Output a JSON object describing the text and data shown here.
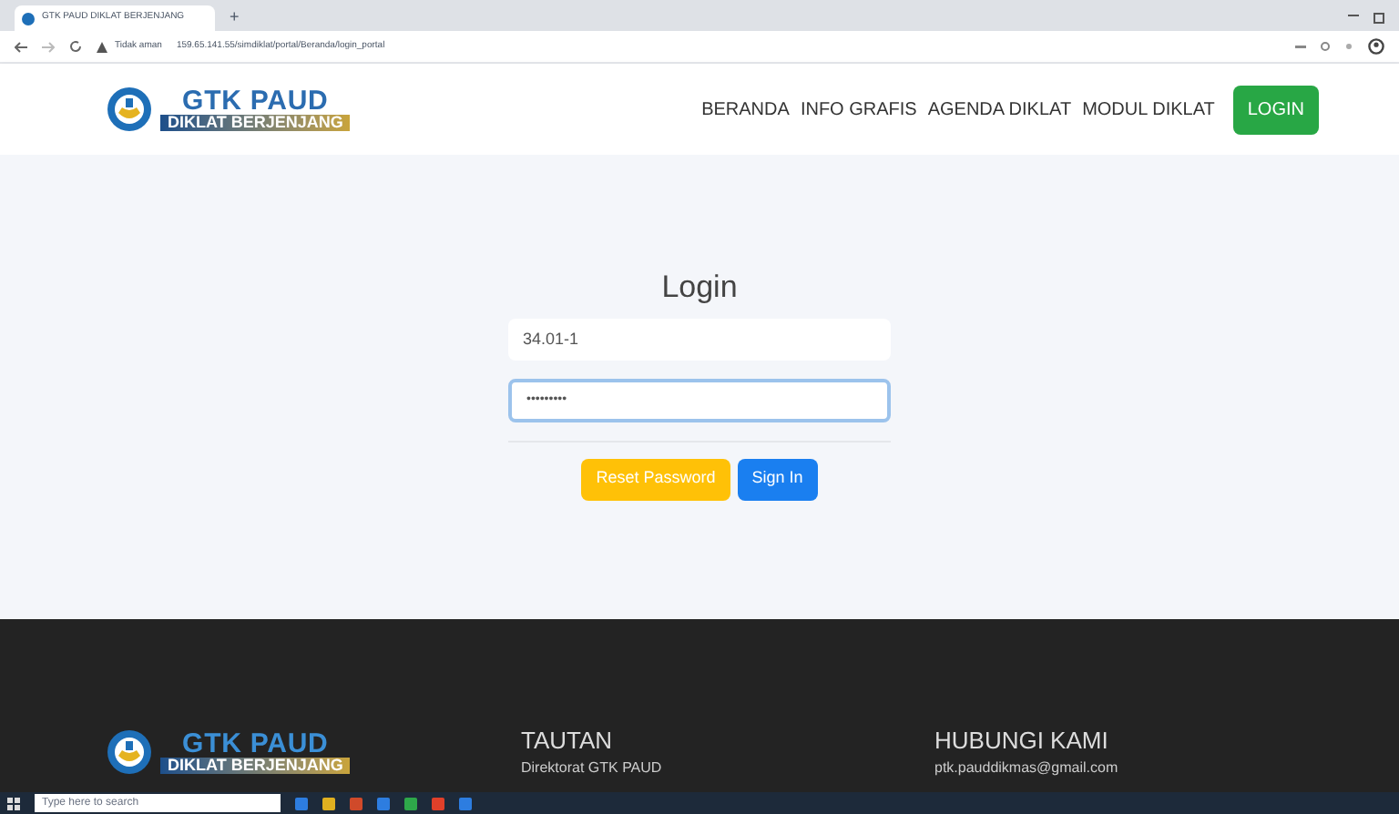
{
  "browser": {
    "tab_title": "GTK PAUD DIKLAT BERJENJANG",
    "new_tab": "+",
    "security": "Tidak aman",
    "url": "159.65.141.55/simdiklat/portal/Beranda/login_portal"
  },
  "header": {
    "logo_top": "GTK PAUD",
    "logo_bottom": "DIKLAT BERJENJANG",
    "nav": [
      {
        "label": "BERANDA",
        "kind": "link"
      },
      {
        "label": "INFO GRAFIS",
        "kind": "link"
      },
      {
        "label": "AGENDA DIKLAT",
        "kind": "link"
      },
      {
        "label": "MODUL DIKLAT",
        "kind": "link"
      },
      {
        "label": "LOGIN",
        "kind": "button"
      }
    ]
  },
  "login": {
    "title": "Login",
    "username": "34.01-1",
    "password": "•••••••••",
    "reset_button": "Reset Password",
    "signin_button": "Sign In"
  },
  "footer": {
    "logo_top": "GTK PAUD",
    "logo_bottom": "DIKLAT BERJENJANG",
    "links_title": "TAUTAN",
    "link": "Direktorat GTK PAUD",
    "contact_title": "HUBUNGI KAMI",
    "email": "ptk.pauddikmas@gmail.com"
  },
  "taskbar": {
    "search_placeholder": "Type here to search"
  }
}
